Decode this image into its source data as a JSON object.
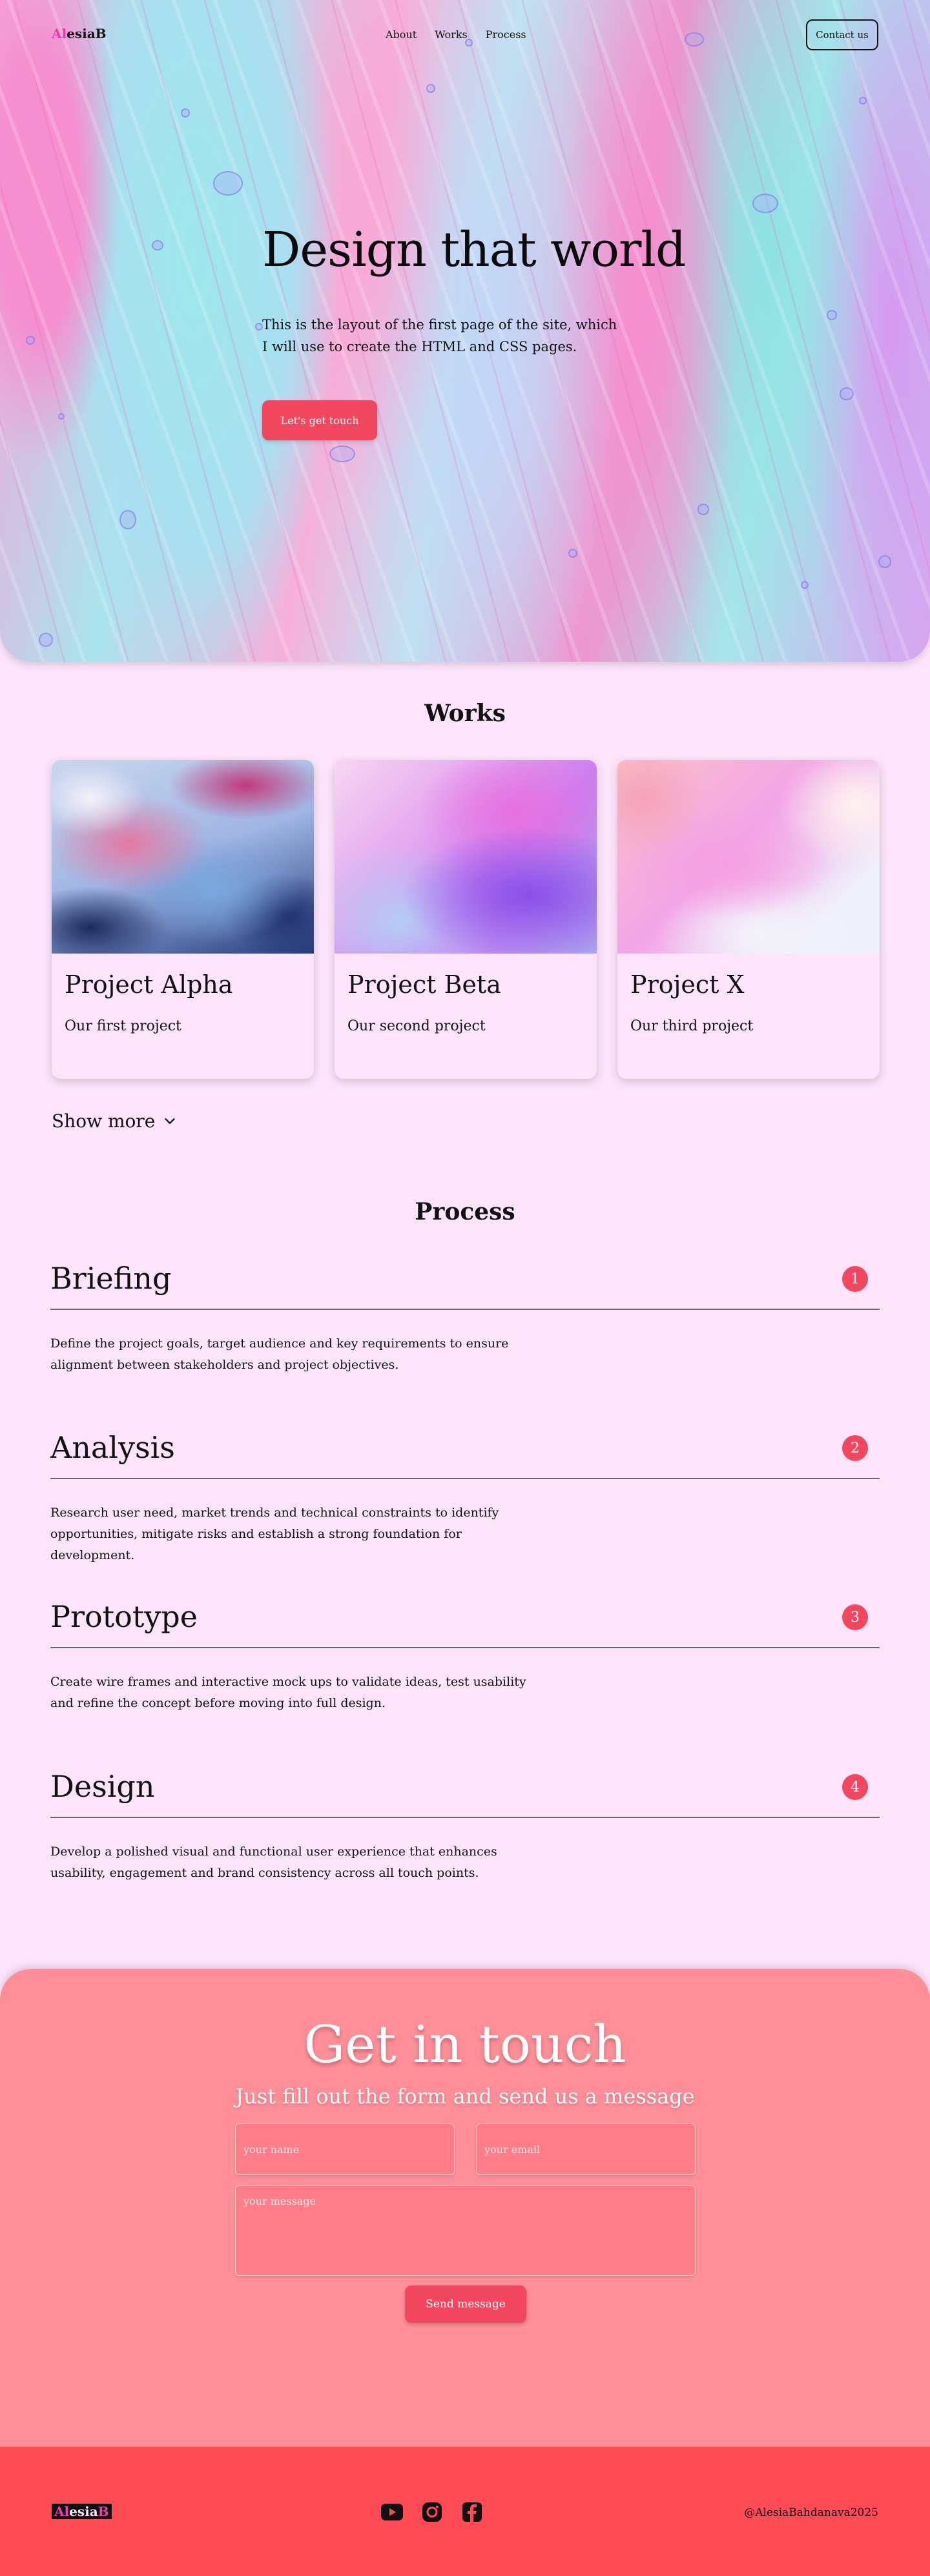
{
  "header": {
    "logo": "AlesiaB",
    "logo_accent": "Al",
    "logo_mid": "esia",
    "logo_end": "B",
    "nav": [
      "About",
      "Works",
      "Process"
    ],
    "contact_button": "Contact us"
  },
  "hero": {
    "title": "Design that world",
    "text": "This is the layout of the first page of the site, which I will use to create the HTML and CSS pages.",
    "cta": "Let's get touch"
  },
  "works": {
    "title": "Works",
    "projects": [
      {
        "title": "Project Alpha",
        "description": "Our first project"
      },
      {
        "title": "Project Beta",
        "description": "Our second project"
      },
      {
        "title": "Project X",
        "description": "Our third project"
      }
    ],
    "show_more": "Show more"
  },
  "process": {
    "title": "Process",
    "steps": [
      {
        "title": "Briefing",
        "number": "1",
        "text": "Define the project goals, target audience and key requirements to ensure alignment between stakeholders and project objectives."
      },
      {
        "title": "Analysis",
        "number": "2",
        "text": "Research user need, market trends and technical constraints to identify opportunities, mitigate risks and establish a strong foundation for development."
      },
      {
        "title": "Prototype",
        "number": "3",
        "text": "Create wire frames and interactive mock ups to validate ideas, test usability and refine the concept before moving into full design."
      },
      {
        "title": "Design",
        "number": "4",
        "text": "Develop a polished visual and functional user experience that enhances usability, engagement and brand consistency across all touch points."
      }
    ]
  },
  "contact": {
    "title": "Get in touch",
    "subtitle": "Just fill out the form and send us a message",
    "name_placeholder": "your name",
    "email_placeholder": "your email",
    "message_placeholder": "your message",
    "send_button": "Send message"
  },
  "footer": {
    "logo": "AlesiaB",
    "social_icons": [
      "youtube-icon",
      "instagram-icon",
      "facebook-icon"
    ],
    "credit": "@AlesiaBahdanava2025"
  },
  "colors": {
    "background": "#fde4fb",
    "accent": "#f2475f",
    "contact_bg": "#ff8e98",
    "footer_bg": "#ff4b55"
  }
}
